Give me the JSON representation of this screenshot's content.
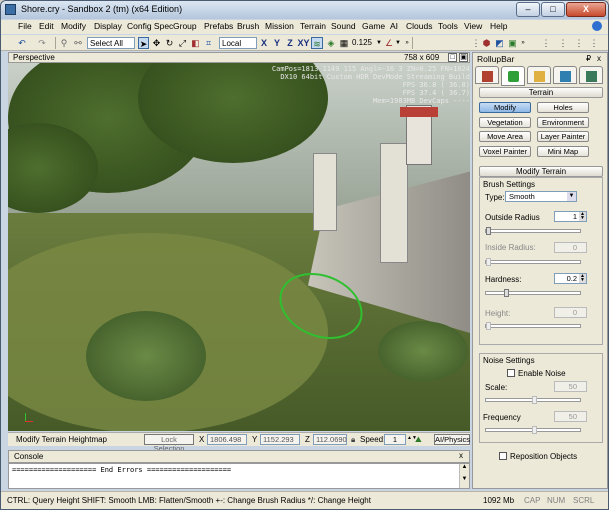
{
  "window": {
    "title": "Shore.cry - Sandbox 2 (tm) (x64 Edition)",
    "minimize": "–",
    "maximize": "□",
    "close": "X"
  },
  "menu": [
    "File",
    "Edit",
    "Modify",
    "Display",
    "Config Spec",
    "Group",
    "Prefabs",
    "Brush",
    "Mission",
    "Terrain",
    "Sound",
    "Game",
    "AI",
    "Clouds",
    "Tools",
    "View",
    "Help"
  ],
  "toolbar": {
    "select_all": "Select All",
    "coord_system": "Local",
    "axis_x": "X",
    "axis_y": "Y",
    "axis_z": "Z",
    "axis_xy": "XY",
    "grid_size": "0.125"
  },
  "viewport": {
    "title": "Perspective",
    "size": "758 x 609",
    "hud_lines": [
      "CamPos=1813 1149 115 Angl=-16 3 ZN=0.25 FN=1024",
      "DX10 64bit Custom HDR DevMode Streaming Build",
      "FPS 36.8 ( 36.8)",
      "FPS 37.4 ( 36.7)",
      "Mem=1983MB DevCaps ----"
    ]
  },
  "viewport_status": {
    "mode": "Modify Terrain Heightmap",
    "lock_selection": "Lock Selection",
    "x_label": "X",
    "x_value": "1806.498",
    "y_label": "Y",
    "y_value": "1152.293",
    "z_label": "Z",
    "z_value": "112.0690",
    "speed_label": "Speed:",
    "speed_value": "1",
    "ai_physics": "AI/Physics"
  },
  "console": {
    "title": "Console",
    "close": "x",
    "line": "==================== End Errors ===================="
  },
  "statusbar": {
    "hint": "CTRL: Query Height  SHIFT: Smooth  LMB: Flatten/Smooth  +-: Change Brush Radius  */: Change Height",
    "memory": "1092 Mb",
    "cap": "CAP",
    "num": "NUM",
    "scrl": "SCRL"
  },
  "rollup": {
    "title": "RollupBar",
    "pin": "₽",
    "close": "x",
    "terrain_section": "Terrain",
    "buttons": [
      {
        "label": "Modify",
        "active": true
      },
      {
        "label": "Holes",
        "active": false
      },
      {
        "label": "Vegetation",
        "active": false
      },
      {
        "label": "Environment",
        "active": false
      },
      {
        "label": "Move Area",
        "active": false
      },
      {
        "label": "Layer Painter",
        "active": false
      },
      {
        "label": "Voxel Painter",
        "active": false
      },
      {
        "label": "Mini Map",
        "active": false
      }
    ],
    "modify_section": "Modify Terrain",
    "brush_settings": "Brush Settings",
    "type_label": "Type:",
    "type_value": "Smooth",
    "outside_radius_label": "Outside Radius",
    "outside_radius_value": "1",
    "inside_radius_label": "Inside Radius:",
    "inside_radius_value": "0",
    "hardness_label": "Hardness:",
    "hardness_value": "0.2",
    "height_label": "Height:",
    "height_value": "0",
    "noise_settings": "Noise Settings",
    "enable_noise": "Enable Noise",
    "scale_label": "Scale:",
    "scale_value": "50",
    "frequency_label": "Frequency",
    "frequency_value": "50",
    "reposition_objects": "Reposition Objects"
  }
}
